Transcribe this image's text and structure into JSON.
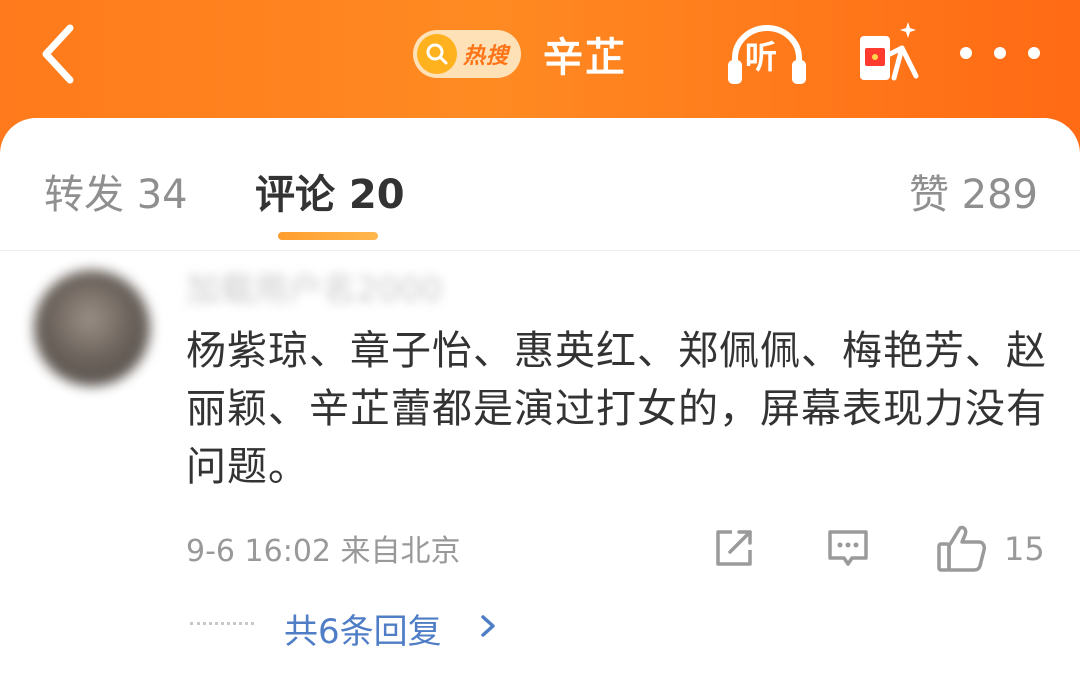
{
  "header": {
    "hot_label": "热搜",
    "title": "辛芷",
    "listen_label": "听",
    "icons": [
      "back-icon",
      "search-icon",
      "headphones-icon",
      "red-packet-icon",
      "more-icon"
    ]
  },
  "tabs": [
    {
      "label": "转发 34",
      "active": false
    },
    {
      "label": "评论 20",
      "active": true
    },
    {
      "label": "赞 289",
      "active": false
    }
  ],
  "comment": {
    "username": "加载用户名2000",
    "text": "杨紫琼、章子怡、惠英红、郑佩佩、梅艳芳、赵丽颖、辛芷蕾都是演过打女的，屏幕表现力没有问题。",
    "meta": "9-6 16:02 来自北京",
    "likes": "15",
    "replies_label": "共6条回复"
  },
  "colors": {
    "header_orange": "#ff7a1c",
    "active_tab_text": "#333333",
    "inactive_tab_text": "#8f8f8f",
    "indicator": "#ffa53a",
    "link_blue": "#4f7ec7"
  }
}
